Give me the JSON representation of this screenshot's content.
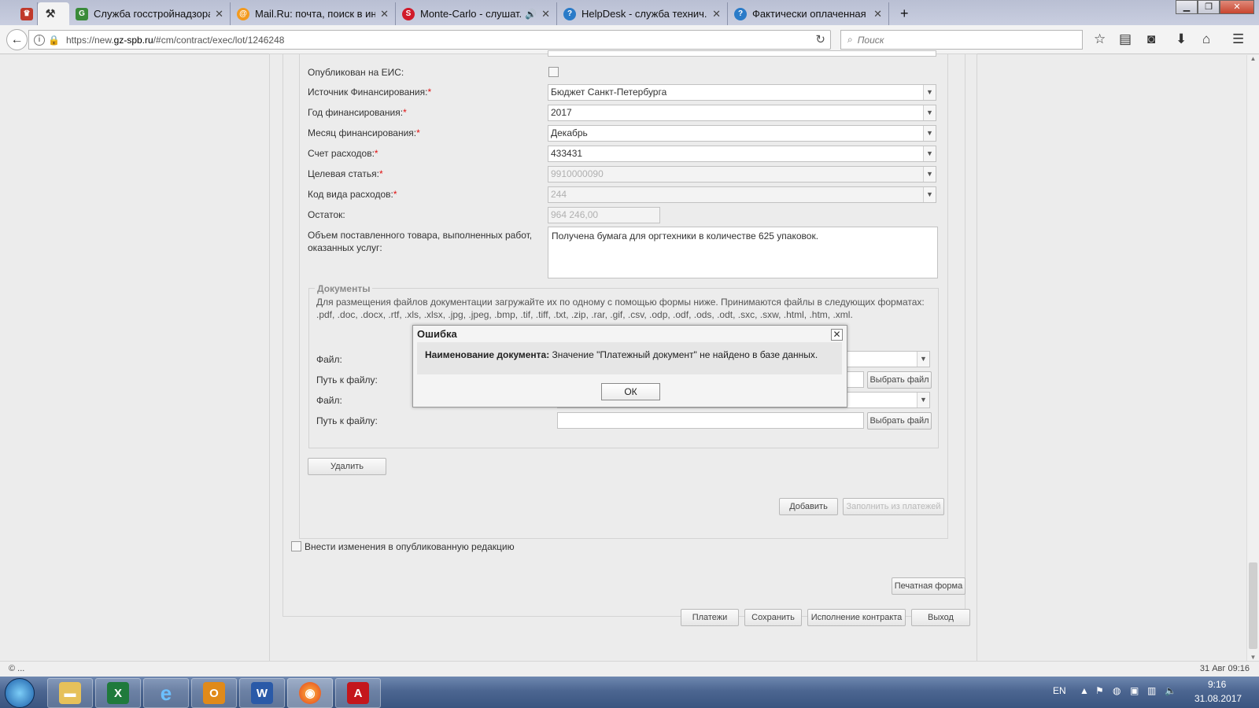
{
  "browser": {
    "tabs": [
      {
        "title": "",
        "favicon": "gz-crest-icon"
      },
      {
        "title": "",
        "favicon": "gavel-icon"
      },
      {
        "title": "Служба госстройнадзора ...",
        "favicon": "gosstroy-icon"
      },
      {
        "title": "Mail.Ru: почта, поиск в ин...",
        "favicon": "mailru-icon"
      },
      {
        "title": "Monte-Carlo - слушат...",
        "favicon": "monte-carlo-icon"
      },
      {
        "title": "HelpDesk - служба технич...",
        "favicon": "helpdesk-icon"
      },
      {
        "title": "Фактически оплаченная с...",
        "favicon": "helpdesk-icon"
      }
    ],
    "new_tab": "+",
    "url_prefix": "https://new.",
    "url_domain": "gz-spb.ru",
    "url_path": "/#cm/contract/exec/lot/1246248",
    "search_placeholder": "Поиск"
  },
  "form": {
    "published_eis_label": "Опубликован на ЕИС:",
    "funding_source_label": "Источник Финансирования:",
    "funding_source_value": "Бюджет Санкт-Петербурга",
    "funding_year_label": "Год финансирования:",
    "funding_year_value": "2017",
    "funding_month_label": "Месяц финансирования:",
    "funding_month_value": "Декабрь",
    "expense_account_label": "Счет расходов:",
    "expense_account_value": "433431",
    "target_article_label": "Целевая статья:",
    "target_article_value": "9910000090",
    "expense_type_label": "Код вида расходов:",
    "expense_type_value": "244",
    "balance_label": "Остаток:",
    "balance_value": "964 246,00",
    "volume_label_1": "Объем поставленного товара, выполненных работ,",
    "volume_label_2": "оказанных услуг:",
    "volume_value": "Получена бумага для оргтехники в количестве 625 упаковок.",
    "required_mark": "*"
  },
  "documents": {
    "legend": "Документы",
    "info": "Для размещения файлов документации загружайте их по одному с помощью формы ниже. Принимаются файлы в следующих форматах: .pdf, .doc, .docx, .rtf, .xls, .xlsx, .jpg, .jpeg, .bmp, .tif, .tiff, .txt, .zip, .rar, .gif, .csv, .odp, .odf, .ods, .odt, .sxc, .sxw, .html, .htm, .xml.",
    "file_label": "Файл:",
    "path_label": "Путь к файлу:",
    "choose_file": "Выбрать файл",
    "delete_button": "Удалить"
  },
  "buttons": {
    "add": "Добавить",
    "fill_from_payments": "Заполнить из платежей",
    "amend_published": "Внести изменения в опубликованную редакцию",
    "print_form": "Печатная форма",
    "payments": "Платежи",
    "save": "Сохранить",
    "contract_execution": "Исполнение контракта",
    "exit": "Выход"
  },
  "dialog": {
    "title": "Ошибка",
    "message_bold": "Наименование документа:",
    "message_text": " Значение \"Платежный документ\" не найдено в базе данных.",
    "ok": "ОК",
    "close": "✕"
  },
  "statusbar": {
    "left": "© ...",
    "right": "31 Авг 09:16"
  },
  "taskbar": {
    "lang": "EN",
    "time": "9:16",
    "date": "31.08.2017"
  }
}
